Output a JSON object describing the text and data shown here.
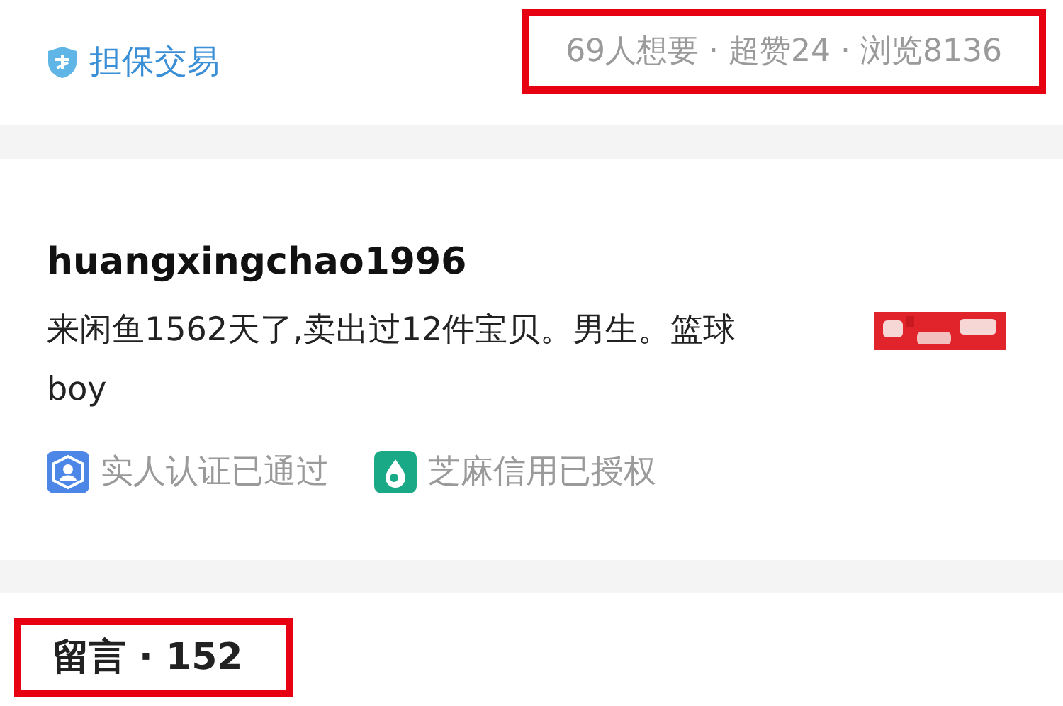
{
  "guarantee": {
    "label": "担保交易"
  },
  "stats": {
    "text": "69人想要 · 超赞24 · 浏览8136",
    "highlighted": true
  },
  "seller": {
    "username": "huangxingchao1996",
    "bio": "来闲鱼1562天了,卖出过12件宝贝。男生。篮球boy",
    "badges": [
      {
        "kind": "real-name",
        "label": "实人认证已通过"
      },
      {
        "kind": "credit",
        "label": "芝麻信用已授权"
      }
    ]
  },
  "comments": {
    "title": "留言 · 152",
    "highlighted": true
  }
}
